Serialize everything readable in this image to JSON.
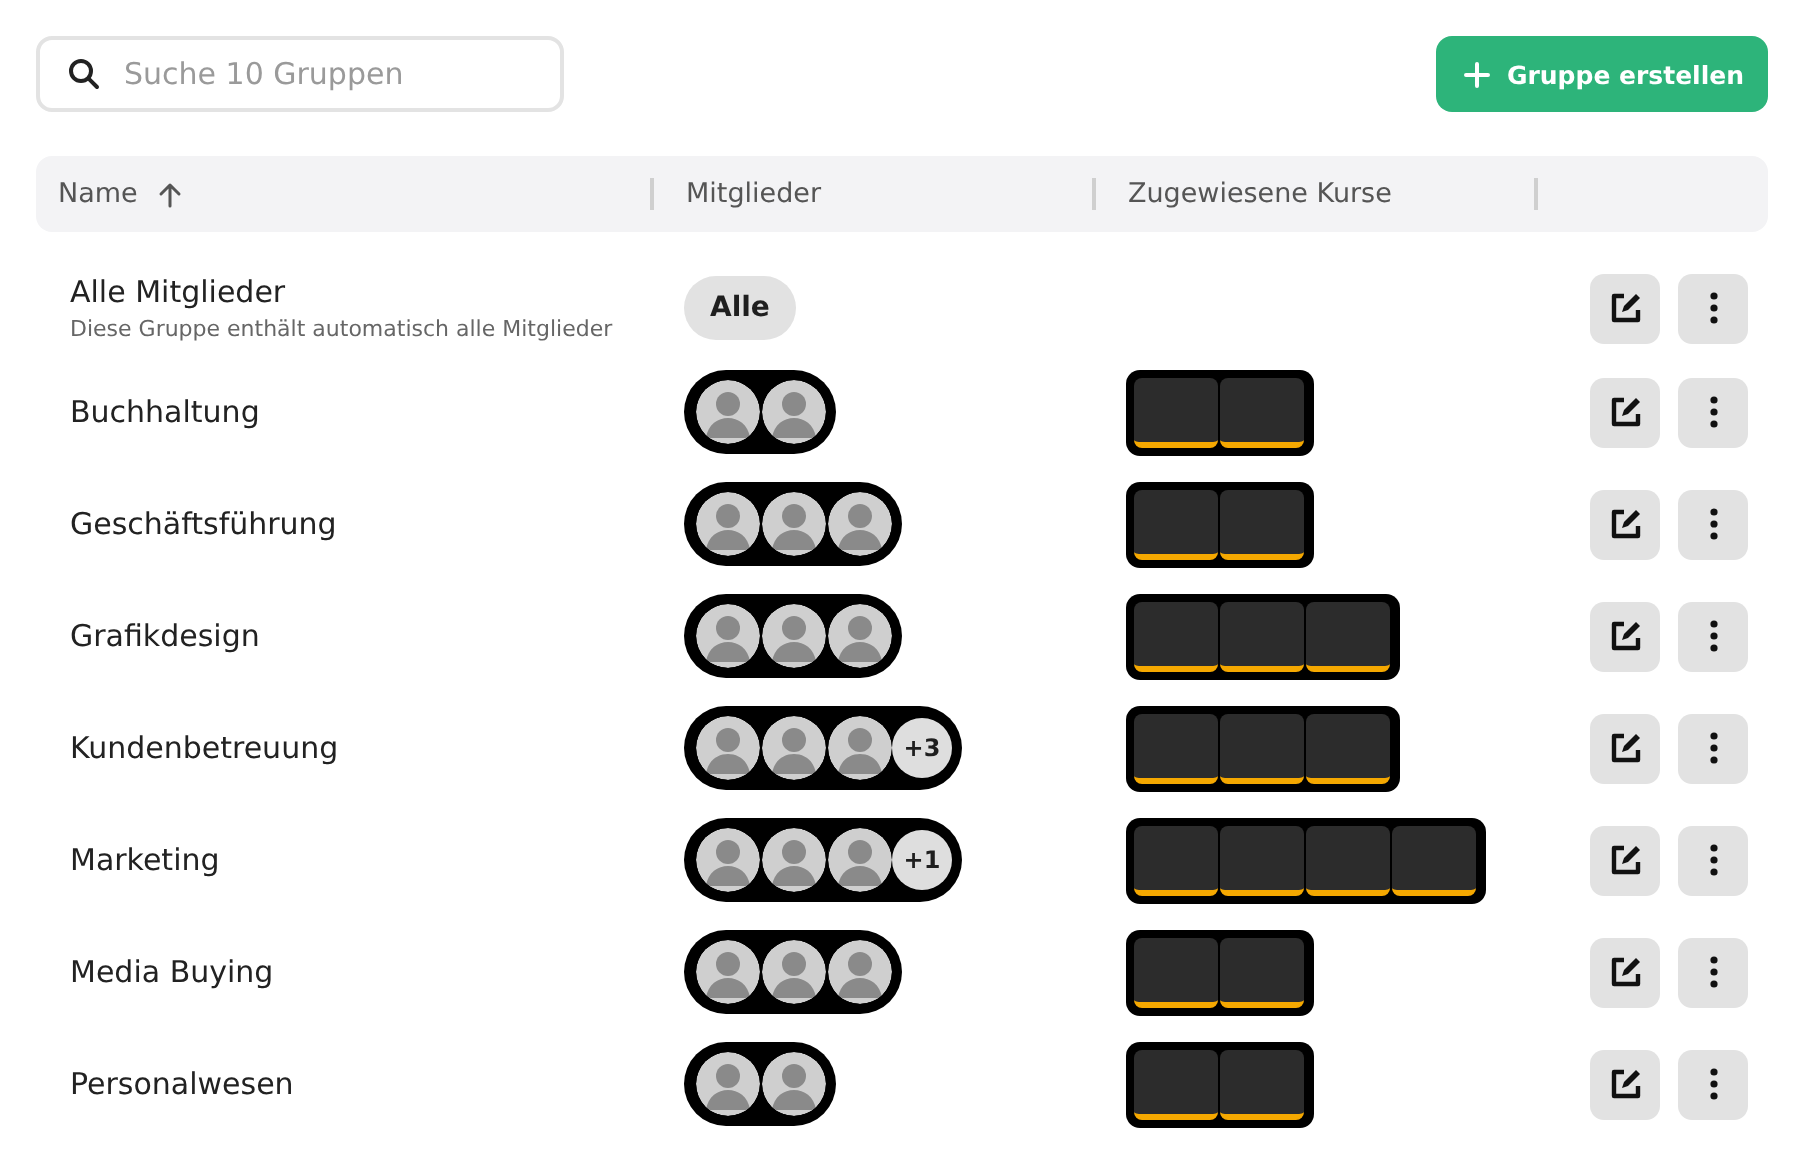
{
  "search": {
    "placeholder": "Suche 10 Gruppen"
  },
  "create_button": {
    "label": "Gruppe erstellen"
  },
  "table": {
    "columns": [
      {
        "label": "Name",
        "sorted": true
      },
      {
        "label": "Mitglieder",
        "sorted": false
      },
      {
        "label": "Zugewiesene Kurse",
        "sorted": false
      }
    ],
    "rows": [
      {
        "name": "Alle Mitglieder",
        "description": "Diese Gruppe enthält automatisch alle Mitglieder",
        "members": {
          "kind": "all",
          "label": "Alle"
        },
        "courses": []
      },
      {
        "name": "Buchhaltung",
        "members": {
          "kind": "avatars",
          "avatars": [
            {
              "kind": "photo"
            },
            {
              "kind": "photo"
            }
          ]
        },
        "courses": [
          {
            "kind": "thumbnail"
          },
          {
            "kind": "thumbnail"
          }
        ]
      },
      {
        "name": "Geschäftsführung",
        "members": {
          "kind": "avatars",
          "avatars": [
            {
              "kind": "photo"
            },
            {
              "kind": "photo"
            },
            {
              "kind": "photo"
            }
          ]
        },
        "courses": [
          {
            "kind": "thumbnail"
          },
          {
            "kind": "thumbnail"
          }
        ]
      },
      {
        "name": "Grafikdesign",
        "members": {
          "kind": "avatars",
          "avatars": [
            {
              "kind": "photo"
            },
            {
              "kind": "photo"
            },
            {
              "kind": "photo"
            }
          ]
        },
        "courses": [
          {
            "kind": "thumbnail"
          },
          {
            "kind": "thumbnail"
          },
          {
            "kind": "thumbnail"
          }
        ]
      },
      {
        "name": "Kundenbetreuung",
        "members": {
          "kind": "avatars",
          "avatars": [
            {
              "kind": "photo"
            },
            {
              "kind": "photo"
            },
            {
              "kind": "photo"
            }
          ],
          "more": "+3"
        },
        "courses": [
          {
            "kind": "thumbnail"
          },
          {
            "kind": "thumbnail"
          },
          {
            "kind": "thumbnail"
          }
        ]
      },
      {
        "name": "Marketing",
        "members": {
          "kind": "avatars",
          "avatars": [
            {
              "kind": "photo"
            },
            {
              "kind": "photo"
            },
            {
              "kind": "photo"
            }
          ],
          "more": "+1"
        },
        "courses": [
          {
            "kind": "thumbnail"
          },
          {
            "kind": "thumbnail"
          },
          {
            "kind": "thumbnail"
          },
          {
            "kind": "thumbnail"
          }
        ]
      },
      {
        "name": "Media Buying",
        "members": {
          "kind": "avatars",
          "avatars": [
            {
              "kind": "photo"
            },
            {
              "kind": "photo"
            },
            {
              "kind": "photo"
            }
          ]
        },
        "courses": [
          {
            "kind": "thumbnail"
          },
          {
            "kind": "thumbnail"
          }
        ]
      },
      {
        "name": "Personalwesen",
        "members": {
          "kind": "avatars",
          "avatars": [
            {
              "kind": "photo"
            },
            {
              "kind": "photo"
            }
          ]
        },
        "courses": [
          {
            "kind": "thumbnail"
          },
          {
            "kind": "thumbnail"
          }
        ]
      }
    ]
  }
}
